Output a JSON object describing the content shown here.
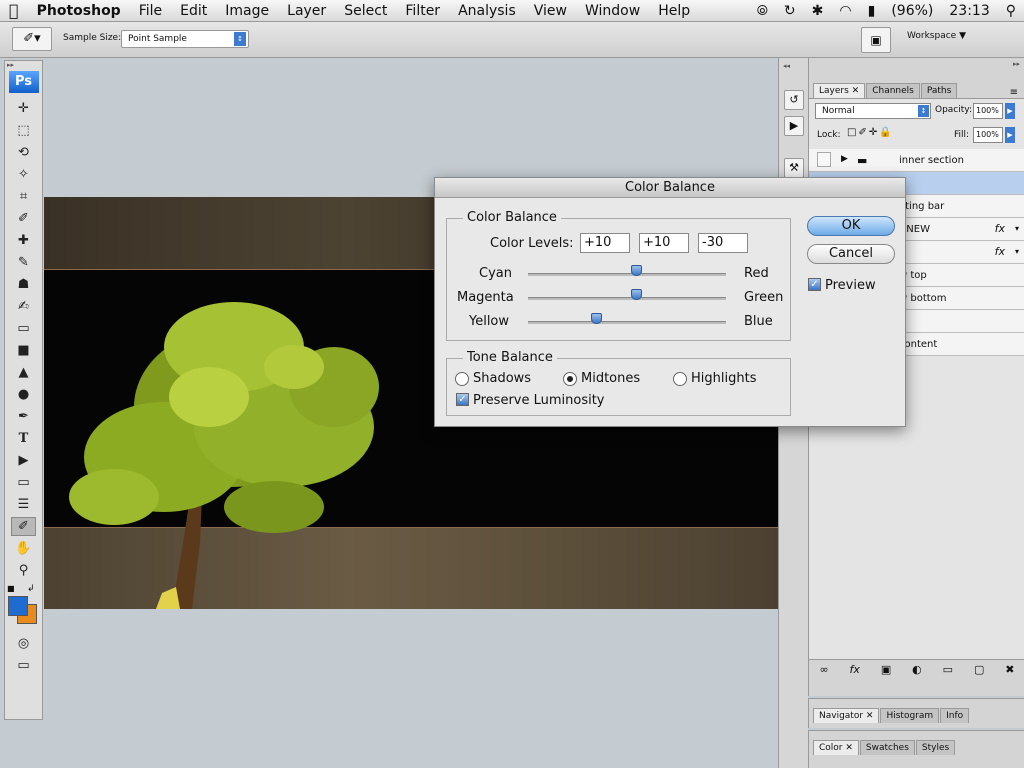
{
  "menubar": {
    "app": "Photoshop",
    "items": [
      "File",
      "Edit",
      "Image",
      "Layer",
      "Select",
      "Filter",
      "Analysis",
      "View",
      "Window",
      "Help"
    ],
    "battery": "(96%)",
    "time": "23:13"
  },
  "options": {
    "sample_size_label": "Sample Size:",
    "sample_size_value": "Point Sample",
    "workspace": "Workspace"
  },
  "toolbox": {
    "logo": "Ps"
  },
  "layers_panel": {
    "tabs": [
      "Layers",
      "Channels",
      "Paths"
    ],
    "blend_mode": "Normal",
    "opacity_label": "Opacity:",
    "opacity": "100%",
    "lock_label": "Lock:",
    "fill_label": "Fill:",
    "fill": "100%",
    "rows": [
      "inner section",
      "",
      "ating bar",
      "r NEW",
      "r",
      "w top",
      "w bottom",
      "",
      "content"
    ]
  },
  "navigator_tabs": [
    "Navigator",
    "Histogram",
    "Info"
  ],
  "color_tabs": [
    "Color",
    "Swatches",
    "Styles"
  ],
  "dialog": {
    "title": "Color Balance",
    "color_balance_group": "Color Balance",
    "color_levels_label": "Color Levels:",
    "levels": [
      "+10",
      "+10",
      "-30"
    ],
    "sliders": [
      {
        "left": "Cyan",
        "right": "Red",
        "value": 10
      },
      {
        "left": "Magenta",
        "right": "Green",
        "value": 10
      },
      {
        "left": "Yellow",
        "right": "Blue",
        "value": -30
      }
    ],
    "tone_group": "Tone Balance",
    "tones": [
      "Shadows",
      "Midtones",
      "Highlights"
    ],
    "selected_tone": "Midtones",
    "preserve_luminosity": "Preserve Luminosity",
    "ok": "OK",
    "cancel": "Cancel",
    "preview": "Preview"
  }
}
